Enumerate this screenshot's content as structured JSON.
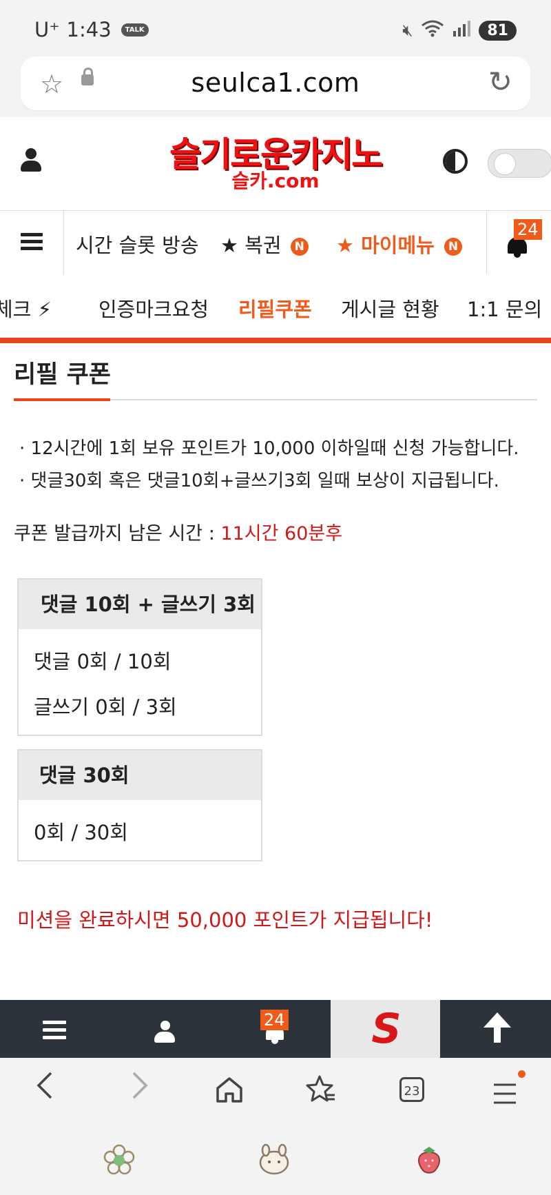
{
  "status_bar": {
    "carrier": "U⁺",
    "time": "1:43",
    "talk": "TALK",
    "battery": "81"
  },
  "browser": {
    "url": "seulca1.com"
  },
  "site": {
    "logo_main": "슬기로운카지노",
    "logo_sub": "슬카.com"
  },
  "nav1": {
    "items": [
      {
        "label": "시간 슬롯 방송"
      },
      {
        "label": "★ 복권",
        "badge": "N"
      },
      {
        "label": "★ 마이메뉴",
        "badge": "N"
      }
    ],
    "notification_count": "24"
  },
  "nav2": {
    "items": [
      {
        "label": "체크 ⚡"
      },
      {
        "label": "인증마크요청"
      },
      {
        "label": "리필쿠폰"
      },
      {
        "label": "게시글 현황"
      },
      {
        "label": "1:1 문의"
      }
    ],
    "active": "리필쿠폰"
  },
  "content": {
    "title": "리필 쿠폰",
    "rules": [
      "· 12시간에 1회 보유 포인트가 10,000 이하일때 신청 가능합니다.",
      "· 댓글30회 혹은 댓글10회+글쓰기3회 일때 보상이 지급됩니다."
    ],
    "remaining_label": "쿠폰 발급까지 남은 시간 : ",
    "remaining_value": "11시간 60분후",
    "mission_boxes": [
      {
        "title": "댓글 10회 + 글쓰기 3회",
        "rows": [
          "댓글 0회 / 10회",
          "글쓰기 0회 / 3회"
        ]
      },
      {
        "title": "댓글 30회",
        "rows": [
          "0회 / 30회"
        ]
      }
    ],
    "mission_message": "미션을 완료하시면 50,000 포인트가 지급됩니다!"
  },
  "bottom_bar": {
    "notification_count": "24",
    "logo_letter": "S"
  },
  "browser_nav": {
    "tabs_count": "23"
  },
  "colors": {
    "accent": "#e8431a",
    "red_text": "#d01818",
    "orange": "#f05a1a",
    "bottom_bar": "#2d333a"
  }
}
